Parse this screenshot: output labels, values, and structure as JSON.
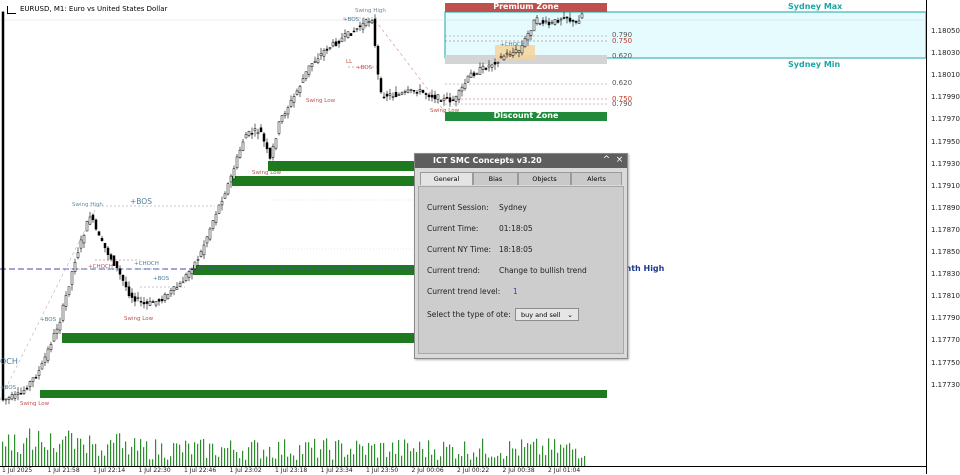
{
  "window": {
    "title": "EURUSD, M1:  Euro vs United States Dollar"
  },
  "price_axis": [
    "1.18050",
    "1.18030",
    "1.18010",
    "1.17990",
    "1.17970",
    "1.17950",
    "1.17930",
    "1.17910",
    "1.17890",
    "1.17870",
    "1.17850",
    "1.17830",
    "1.17810",
    "1.17790",
    "1.17770",
    "1.17750",
    "1.17730"
  ],
  "time_axis": [
    "1 Jul 2025",
    "1 Jul 21:58",
    "1 Jul 22:14",
    "1 Jul 22:30",
    "1 Jul 22:46",
    "1 Jul 23:02",
    "1 Jul 23:18",
    "1 Jul 23:34",
    "1 Jul 23:50",
    "2 Jul 00:06",
    "2 Jul 00:22",
    "2 Jul 00:38",
    "2 Jul 01:04"
  ],
  "zones": {
    "premium": "Premium Zone",
    "discount": "Discount Zone"
  },
  "sessions": {
    "max": "Sydney Max",
    "min": "Sydney Min"
  },
  "fib": {
    "l1": "0.790",
    "l2": "0.750",
    "l3": "0.620",
    "l4": "0.620",
    "l5": "0.750",
    "l6": "0.790"
  },
  "markers": {
    "swing_high_top": "Swing High",
    "bos_top": "+BOS",
    "ll_top": "LL",
    "hl_top": "+BOS",
    "swing_low_a": "Swing Low",
    "swing_low_b": "Swing Low",
    "swing_high_left": "Swing High",
    "bos_left": "+BOS",
    "choch": "+CHOCH",
    "choch_red": "+CHOCH",
    "bos_mid": "+BOS",
    "swing_low_mid": "Swing Low",
    "bos_low": "+BOS",
    "swing_low_left": "Swing Low",
    "swing_low_c": "Swing Low",
    "och": "OCH",
    "bos_tiny": "+BOS",
    "choch_right": "+CHOCH"
  },
  "month_high": "onth High",
  "panel": {
    "title": "ICT SMC Concepts v3.20",
    "minimize": "^",
    "close": "×",
    "tabs": [
      {
        "label": "General"
      },
      {
        "label": "Bias"
      },
      {
        "label": "Objects"
      },
      {
        "label": "Alerts"
      }
    ],
    "rows": {
      "session_label": "Current Session:",
      "session_value": "Sydney",
      "time_label": "Current Time:",
      "time_value": "01:18:05",
      "ny_label": "Current NY Time:",
      "ny_value": "18:18:05",
      "trend_label": "Current trend:",
      "trend_value": "Change to bullish trend",
      "level_label": "Current trend level:",
      "level_value": "1",
      "ote_label": "Select the type of ote:",
      "ote_value": "buy and sell"
    }
  },
  "colors": {
    "green_zone": "#1f7a1f",
    "premium": "#c0504d",
    "discount": "#1e8a3a",
    "session": "#1ba6a6",
    "session_fill": "#e6fbfd"
  }
}
